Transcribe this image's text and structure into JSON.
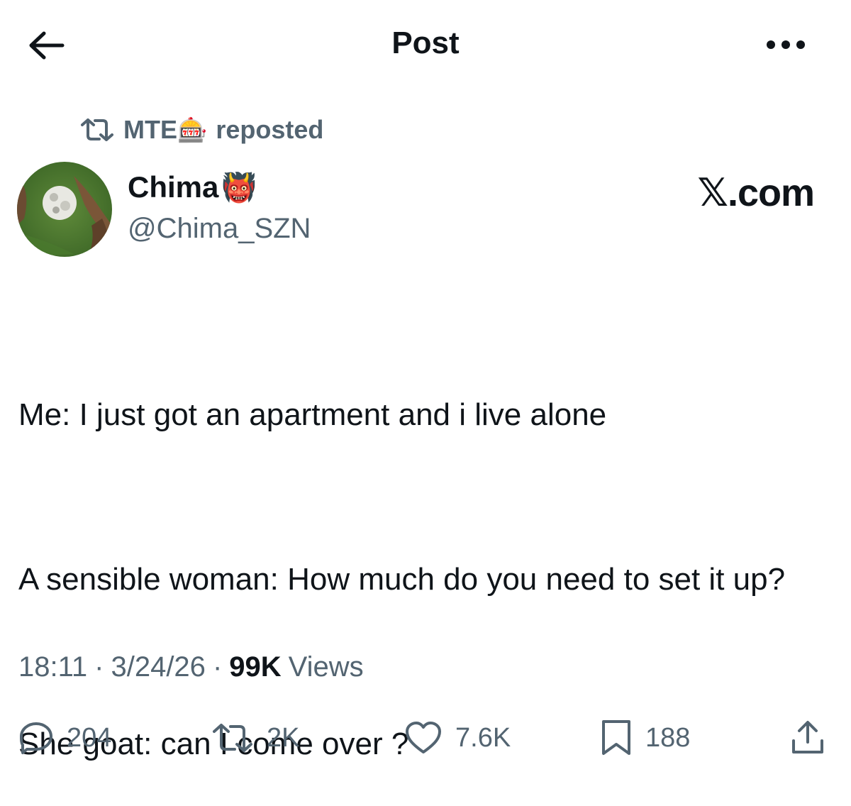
{
  "header": {
    "title": "Post"
  },
  "repost": {
    "user": "MTE",
    "user_emoji": "🎰",
    "suffix": "reposted"
  },
  "author": {
    "name": "Chima",
    "name_emoji": "👹",
    "handle": "@Chima_SZN"
  },
  "brand": "𝕏.com",
  "tweet": {
    "lines": [
      "Me: I just got an apartment and i live alone",
      "A sensible woman: How much do you need to set it up?",
      "She goat: can I come over ?"
    ]
  },
  "meta": {
    "time": "18:11",
    "sep1": "·",
    "date": "3/24/26",
    "sep2": "·",
    "views_count": "99K",
    "views_label": "Views"
  },
  "actions": {
    "replies": "204",
    "reposts": "2K",
    "likes": "7.6K",
    "bookmarks": "188"
  },
  "colors": {
    "text": "#0f1419",
    "secondary": "#536471",
    "background": "#ffffff"
  },
  "icons": [
    "back-arrow-icon",
    "more-icon",
    "repost-icon",
    "reply-icon",
    "like-icon",
    "bookmark-icon",
    "share-icon"
  ]
}
